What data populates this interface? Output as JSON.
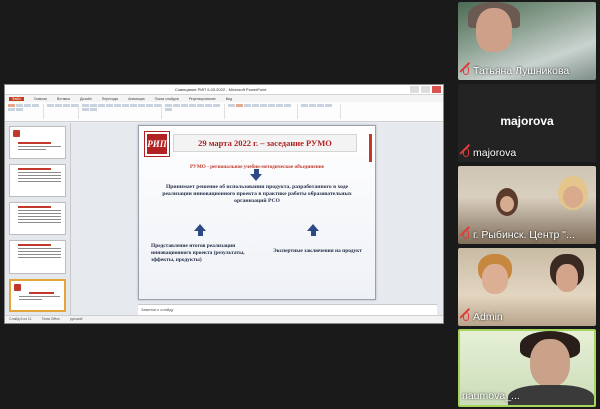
{
  "app": {
    "window_title": "Совещание РИП 5.03.2022 - Microsoft PowerPoint"
  },
  "ppt": {
    "menu": [
      "Файл",
      "Главная",
      "Вставка",
      "Дизайн",
      "Переходы",
      "Анимация",
      "Показ слайдов",
      "Рецензирование",
      "Вид"
    ],
    "slide": {
      "logo_text": "РИП",
      "title": "29 марта 2022 г. – заседание РУМО",
      "subtitle": "РУМО - региональное учебно-методическое объединение",
      "middle_text": "Принимает решение об использовании продукта, разработанного в ходе реализации инновационного проекта в практике работы образовательных организаций РСО",
      "left_text": "Представление итогов реализации инновационного проекта (результаты, эффекты, продукты)",
      "right_text": "Экспертные заключения на продукт"
    },
    "notes_placeholder": "Заметки к слайду",
    "status": [
      "Слайд 6 из 11",
      "Тема Office",
      "русский"
    ],
    "thumbnails": [
      {
        "num": "1",
        "selected": false
      },
      {
        "num": "2",
        "selected": false
      },
      {
        "num": "3",
        "selected": false
      },
      {
        "num": "4",
        "selected": false
      },
      {
        "num": "5",
        "selected": false
      },
      {
        "num": "6",
        "selected": true
      }
    ]
  },
  "participants": [
    {
      "name": "Татьяна Лушникова",
      "muted": true
    },
    {
      "name": "majorova",
      "muted": true,
      "display_name": "majorova"
    },
    {
      "name": "г. Рыбинск. Центр \"...",
      "muted": true
    },
    {
      "name": "Admin",
      "muted": true
    },
    {
      "name": "naumova_...",
      "muted": false,
      "active_speaker": true
    }
  ],
  "colors": {
    "accent_red": "#b22222",
    "active_speaker_border": "#a6d65c",
    "muted_icon": "#e23b3b"
  }
}
